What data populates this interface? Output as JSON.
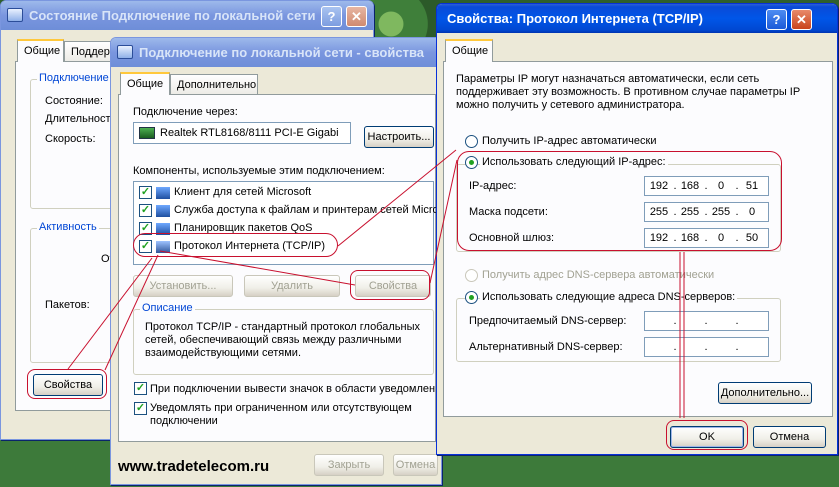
{
  "status_window": {
    "title": "Состояние Подключение по локальной сети",
    "tabs": [
      "Общие",
      "Поддер"
    ],
    "group_connection": "Подключение",
    "labels": [
      "Состояние:",
      "Длительност",
      "Скорость:"
    ],
    "group_activity": "Активность",
    "activity_partial": "От",
    "packets_label": "Пакетов:",
    "properties_button": "Свойства"
  },
  "props_window": {
    "title": "Подключение по локальной сети - свойства",
    "tabs": [
      "Общие",
      "Дополнительно"
    ],
    "connect_via_label": "Подключение через:",
    "adapter_name": "Realtek RTL8168/8111 PCI-E Gigabi",
    "configure_button": "Настроить...",
    "components_label": "Компоненты, используемые этим подключением:",
    "components": [
      {
        "label": "Клиент для сетей Microsoft",
        "checked": true
      },
      {
        "label": "Служба доступа к файлам и принтерам сетей Micro",
        "checked": true
      },
      {
        "label": "Планировщик пакетов QoS",
        "checked": true
      },
      {
        "label": "Протокол Интернета (TCP/IP)",
        "checked": true
      }
    ],
    "install_button": "Установить...",
    "remove_button": "Удалить",
    "properties_button": "Свойства",
    "description_title": "Описание",
    "description_text": "Протокол TCP/IP - стандартный протокол глобальных сетей, обеспечивающий связь между различными взаимодействующими сетями.",
    "show_icon_label": "При подключении вывести значок в области уведомлен",
    "notify_label": "Уведомлять при ограниченном или отсутствующем подключении",
    "close_button": "Закрыть",
    "cancel_button": "Отмена"
  },
  "tcpip_window": {
    "title": "Свойства: Протокол Интернета (TCP/IP)",
    "tab": "Общие",
    "intro_text": "Параметры IP могут назначаться автоматически, если сеть поддерживает эту возможность. В противном случае параметры IP можно получить у сетевого администратора.",
    "auto_ip_label": "Получить IP-адрес автоматически",
    "manual_ip_label": "Использовать следующий IP-адрес:",
    "ip_label": "IP-адрес:",
    "ip_value": [
      "192",
      "168",
      "0",
      "51"
    ],
    "mask_label": "Маска подсети:",
    "mask_value": [
      "255",
      "255",
      "255",
      "0"
    ],
    "gateway_label": "Основной шлюз:",
    "gateway_value": [
      "192",
      "168",
      "0",
      "50"
    ],
    "auto_dns_label": "Получить адрес DNS-сервера автоматически",
    "manual_dns_label": "Использовать следующие адреса DNS-серверов:",
    "preferred_dns_label": "Предпочитаемый DNS-сервер:",
    "alternate_dns_label": "Альтернативный DNS-сервер:",
    "advanced_button": "Дополнительно...",
    "ok_button": "OK",
    "cancel_button": "Отмена"
  },
  "watermark": "www.tradetelecom.ru",
  "colors": {
    "annotation": "#c8102e",
    "accent": "#0046d5",
    "check": "#21a121"
  },
  "icons": [
    "network-window-icon",
    "network-adapter-icon",
    "network-client-icon",
    "file-sharing-icon",
    "qos-icon",
    "protocol-icon",
    "help-icon",
    "close-icon"
  ]
}
